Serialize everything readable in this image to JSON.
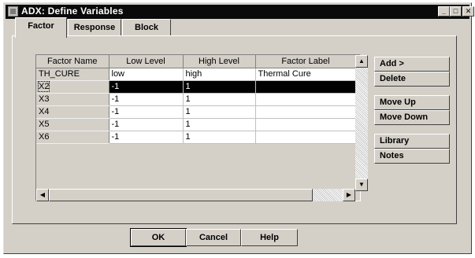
{
  "window": {
    "title": "ADX: Define Variables"
  },
  "tabs": [
    {
      "label": "Factor",
      "active": true
    },
    {
      "label": "Response",
      "active": false
    },
    {
      "label": "Block",
      "active": false
    }
  ],
  "grid": {
    "columns": [
      "Factor Name",
      "Low Level",
      "High Level",
      "Factor Label"
    ],
    "rows": [
      [
        "TH_CURE",
        "low",
        "high",
        "Thermal Cure"
      ],
      [
        "X2",
        "-1",
        "1",
        ""
      ],
      [
        "X3",
        "-1",
        "1",
        ""
      ],
      [
        "X4",
        "-1",
        "1",
        ""
      ],
      [
        "X5",
        "-1",
        "1",
        ""
      ],
      [
        "X6",
        "-1",
        "1",
        ""
      ]
    ],
    "selected_row": 1
  },
  "side_buttons": {
    "add": "Add >",
    "delete": "Delete",
    "move_up": "Move Up",
    "move_down": "Move Down",
    "library": "Library",
    "notes": "Notes"
  },
  "bottom_buttons": {
    "ok": "OK",
    "cancel": "Cancel",
    "help": "Help"
  },
  "icons": {
    "app": "app-icon",
    "minimize": "minimize-icon",
    "maximize": "maximize-icon",
    "close": "close-icon"
  }
}
